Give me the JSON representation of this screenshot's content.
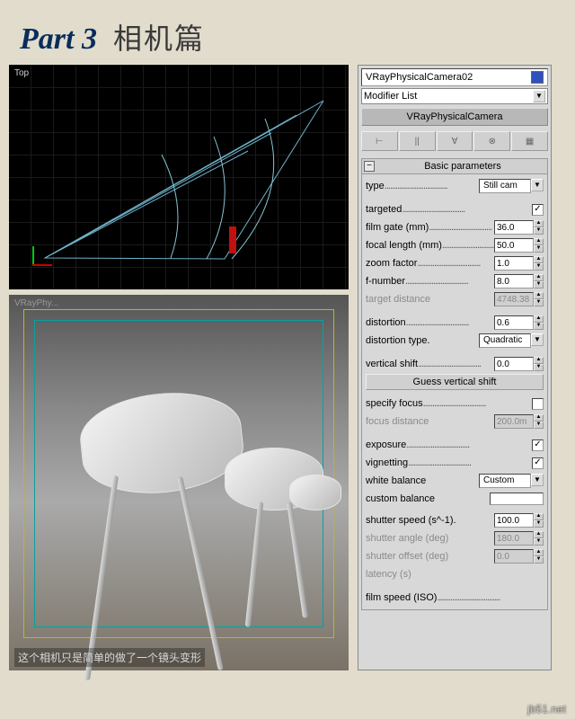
{
  "header": {
    "part": "Part 3",
    "subtitle": "相机篇"
  },
  "viewport_top": {
    "label": "Top"
  },
  "viewport_bottom": {
    "label": "VRayPhy...",
    "caption": "这个相机只是简单的做了一个镜头变形"
  },
  "panel": {
    "object_name": "VRayPhysicalCamera02",
    "modifier_list": "Modifier List",
    "stack_item": "VRayPhysicalCamera",
    "rollout_title": "Basic parameters",
    "toolbar": [
      "⊢",
      "||",
      "∀",
      "⊗",
      "▦"
    ],
    "rows": {
      "type": {
        "label": "type",
        "value": "Still cam"
      },
      "targeted": {
        "label": "targeted",
        "checked": true
      },
      "film_gate": {
        "label": "film gate (mm)",
        "value": "36.0"
      },
      "focal_length": {
        "label": "focal length (mm)",
        "value": "50.0"
      },
      "zoom_factor": {
        "label": "zoom factor",
        "value": "1.0"
      },
      "f_number": {
        "label": "f-number",
        "value": "8.0"
      },
      "target_distance": {
        "label": "target distance",
        "value": "4748.38",
        "disabled": true
      },
      "distortion": {
        "label": "distortion",
        "value": "0.6"
      },
      "distortion_type": {
        "label": "distortion type.",
        "value": "Quadratic"
      },
      "vertical_shift": {
        "label": "vertical shift",
        "value": "0.0"
      },
      "guess_btn": "Guess vertical shift",
      "specify_focus": {
        "label": "specify focus",
        "checked": false
      },
      "focus_distance": {
        "label": "focus distance",
        "value": "200.0m",
        "disabled": true
      },
      "exposure": {
        "label": "exposure",
        "checked": true
      },
      "vignetting": {
        "label": "vignetting",
        "checked": true
      },
      "white_balance": {
        "label": "white balance",
        "value": "Custom"
      },
      "custom_balance": {
        "label": "custom balance"
      },
      "shutter_speed": {
        "label": "shutter speed (s^-1).",
        "value": "100.0"
      },
      "shutter_angle": {
        "label": "shutter angle (deg)",
        "value": "180.0",
        "disabled": true
      },
      "shutter_offset": {
        "label": "shutter offset (deg)",
        "value": "0.0",
        "disabled": true
      },
      "latency": {
        "label": "latency (s)",
        "disabled": true
      },
      "film_speed": {
        "label": "film speed (ISO)"
      }
    }
  },
  "watermark": "jb51.net"
}
